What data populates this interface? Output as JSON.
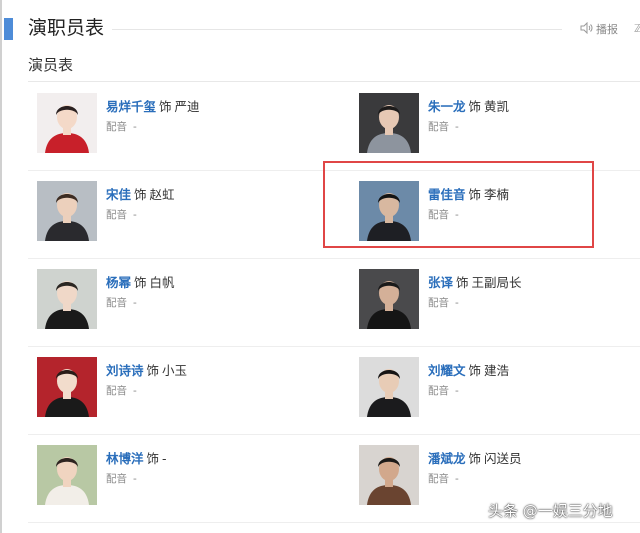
{
  "section": {
    "title": "演职员表",
    "report_label": "播报",
    "extra_label": "ℤ"
  },
  "cast_heading": "演员表",
  "dub_label": "配音",
  "dub_value": "-",
  "as_word": "饰",
  "cast": [
    {
      "actor": "易烊千玺",
      "role": "严迪",
      "photo_bg": "#f2eeee",
      "outfit": "#c8202a",
      "hair": "#2a2020",
      "skin": "#f4d9c8"
    },
    {
      "actor": "朱一龙",
      "role": "黄凯",
      "photo_bg": "#3a3a3c",
      "outfit": "#8d949e",
      "hair": "#1c1a1a",
      "skin": "#e6c8b4"
    },
    {
      "actor": "宋佳",
      "role": "赵虹",
      "photo_bg": "#b8bec4",
      "outfit": "#2a2a2e",
      "hair": "#3c2c22",
      "skin": "#ecd0bc"
    },
    {
      "actor": "雷佳音",
      "role": "李楠",
      "photo_bg": "#6c8aa8",
      "outfit": "#1e1f24",
      "hair": "#141414",
      "skin": "#d8b8a0"
    },
    {
      "actor": "杨幂",
      "role": "白帆",
      "photo_bg": "#cfd3cf",
      "outfit": "#1a1a1a",
      "hair": "#2a2622",
      "skin": "#f0d8c8"
    },
    {
      "actor": "张译",
      "role": "王副局长",
      "photo_bg": "#4a4a4c",
      "outfit": "#151515",
      "hair": "#1a1a1a",
      "skin": "#d4b098"
    },
    {
      "actor": "刘诗诗",
      "role": "小玉",
      "photo_bg": "#b4242c",
      "outfit": "#1a1a1a",
      "hair": "#2a1c18",
      "skin": "#f2dccc"
    },
    {
      "actor": "刘耀文",
      "role": "建浩",
      "photo_bg": "#dcdcdc",
      "outfit": "#1b1b1d",
      "hair": "#161414",
      "skin": "#e8ccb6"
    },
    {
      "actor": "林博洋",
      "role": "-",
      "photo_bg": "#b8c8a4",
      "outfit": "#f2eee8",
      "hair": "#2e2420",
      "skin": "#f0d4c0"
    },
    {
      "actor": "潘斌龙",
      "role": "闪送员",
      "photo_bg": "#d8d4d0",
      "outfit": "#6a4430",
      "hair": "#1c1a18",
      "skin": "#d2a88c"
    }
  ],
  "watermark": "头条 @一娱三分地"
}
